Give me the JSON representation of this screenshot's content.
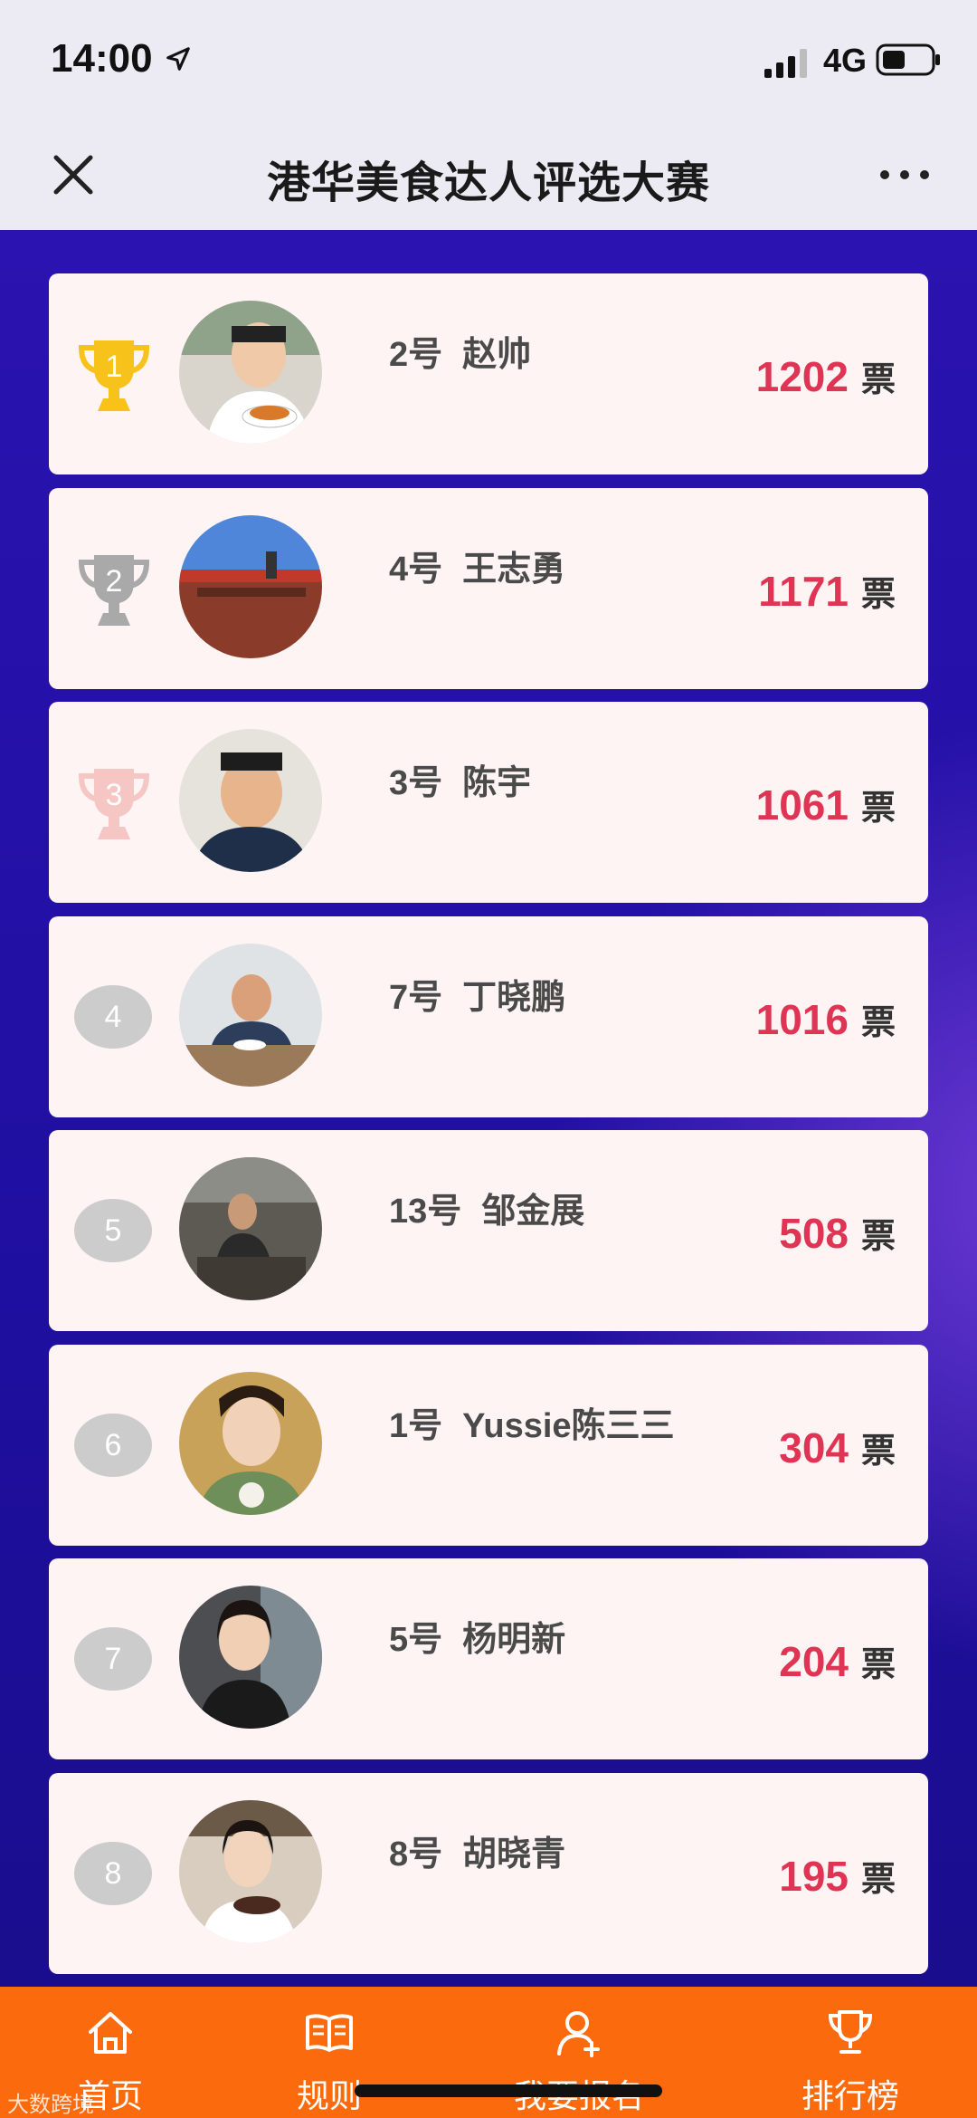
{
  "status_bar": {
    "time": "14:00",
    "network": "4G"
  },
  "header": {
    "title": "港华美食达人评选大赛"
  },
  "ranking": [
    {
      "rank": "1",
      "number": "2号",
      "name": "赵帅",
      "votes": "1202",
      "unit": "票",
      "badge": "gold"
    },
    {
      "rank": "2",
      "number": "4号",
      "name": "王志勇",
      "votes": "1171",
      "unit": "票",
      "badge": "silver"
    },
    {
      "rank": "3",
      "number": "3号",
      "name": "陈宇",
      "votes": "1061",
      "unit": "票",
      "badge": "bronze"
    },
    {
      "rank": "4",
      "number": "7号",
      "name": "丁晓鹏",
      "votes": "1016",
      "unit": "票",
      "badge": "circle"
    },
    {
      "rank": "5",
      "number": "13号",
      "name": "邹金展",
      "votes": "508",
      "unit": "票",
      "badge": "circle"
    },
    {
      "rank": "6",
      "number": "1号",
      "name": "Yussie陈三三",
      "votes": "304",
      "unit": "票",
      "badge": "circle"
    },
    {
      "rank": "7",
      "number": "5号",
      "name": "杨明新",
      "votes": "204",
      "unit": "票",
      "badge": "circle"
    },
    {
      "rank": "8",
      "number": "8号",
      "name": "胡晓青",
      "votes": "195",
      "unit": "票",
      "badge": "circle"
    }
  ],
  "colors": {
    "gold": "#f7c21a",
    "silver": "#a9a9a9",
    "bronze": "#f6c6c4",
    "accent": "#e03455",
    "nav": "#fb6a0d"
  },
  "bottom_nav": [
    {
      "label": "首页",
      "icon": "home-icon"
    },
    {
      "label": "规则",
      "icon": "book-icon"
    },
    {
      "label": "我要报名",
      "icon": "user-add-icon"
    },
    {
      "label": "排行榜",
      "icon": "trophy-icon"
    }
  ],
  "watermark": "大数跨境"
}
